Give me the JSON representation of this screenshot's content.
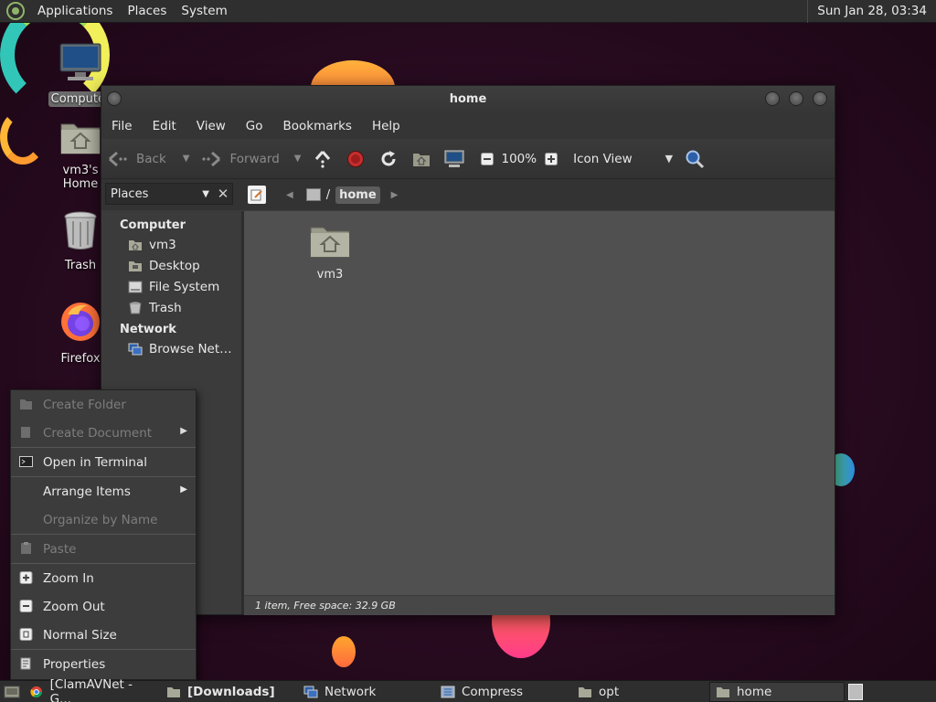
{
  "top_panel": {
    "menus": [
      "Applications",
      "Places",
      "System"
    ],
    "clock": "Sun Jan 28, 03:34"
  },
  "desktop": {
    "icons": [
      {
        "label": "Computer"
      },
      {
        "label": "vm3's Home"
      },
      {
        "label": "Trash"
      },
      {
        "label": "Firefox"
      }
    ]
  },
  "window": {
    "title": "home",
    "menu": [
      "File",
      "Edit",
      "View",
      "Go",
      "Bookmarks",
      "Help"
    ],
    "toolbar": {
      "back": "Back",
      "forward": "Forward",
      "zoom": "100%",
      "view_mode": "Icon View"
    },
    "sidebar": {
      "selector": "Places",
      "sections": [
        {
          "title": "Computer",
          "items": [
            "vm3",
            "Desktop",
            "File System",
            "Trash"
          ]
        },
        {
          "title": "Network",
          "items": [
            "Browse Net…"
          ]
        }
      ]
    },
    "pathbar": {
      "separator": "/",
      "current": "home"
    },
    "files": [
      {
        "name": "vm3"
      }
    ],
    "status": "1 item, Free space: 32.9 GB"
  },
  "context_menu": {
    "items": [
      {
        "label": "Create Folder",
        "enabled": false
      },
      {
        "label": "Create Document",
        "enabled": false,
        "submenu": true
      },
      {
        "label": "Open in Terminal",
        "enabled": true
      },
      {
        "label": "Arrange Items",
        "enabled": true,
        "submenu": true
      },
      {
        "label": "Organize by Name",
        "enabled": false
      },
      {
        "label": "Paste",
        "enabled": false
      },
      {
        "label": "Zoom In",
        "enabled": true
      },
      {
        "label": "Zoom Out",
        "enabled": true
      },
      {
        "label": "Normal Size",
        "enabled": true
      },
      {
        "label": "Properties",
        "enabled": true
      }
    ]
  },
  "taskbar": {
    "tasks": [
      {
        "label": "[ClamAVNet - G...",
        "active": false
      },
      {
        "label": "[Downloads]",
        "active": false
      },
      {
        "label": "Network",
        "active": false
      },
      {
        "label": "Compress",
        "active": false
      },
      {
        "label": "opt",
        "active": false
      },
      {
        "label": "home",
        "active": true
      }
    ]
  }
}
